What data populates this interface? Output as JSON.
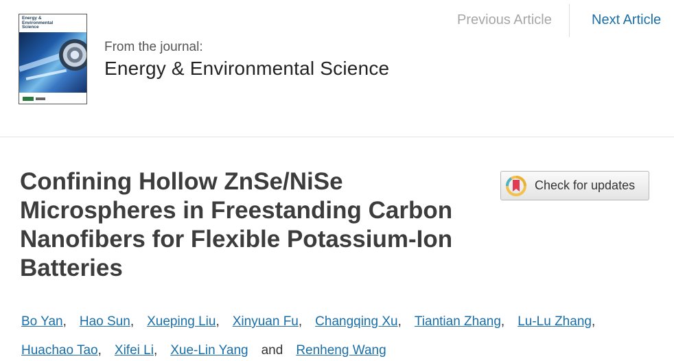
{
  "journal": {
    "cover_title": "Energy & Environmental Science",
    "from_label": "From the journal:",
    "name": "Energy & Environmental Science"
  },
  "nav": {
    "previous": "Previous Article",
    "next": "Next Article",
    "previous_color": "#a6a6a6",
    "next_color": "#1a6ea8"
  },
  "article": {
    "title": "Confining Hollow ZnSe/NiSe Microspheres in Freestanding Carbon Nanofibers for Flexible Potassium-Ion Batteries"
  },
  "check_updates": {
    "label": "Check for updates",
    "icon": "crossmark-icon"
  },
  "authors": [
    "Bo Yan",
    "Hao Sun",
    "Xueping Liu",
    "Xinyuan Fu",
    "Changqing Xu",
    "Tiantian Zhang",
    "Lu-Lu Zhang",
    "Huachao Tao",
    "Xifei Li",
    "Xue-Lin Yang",
    "Renheng Wang"
  ],
  "author_separator": ",",
  "author_conjunction": "and",
  "link_color": "#1a6ea8"
}
